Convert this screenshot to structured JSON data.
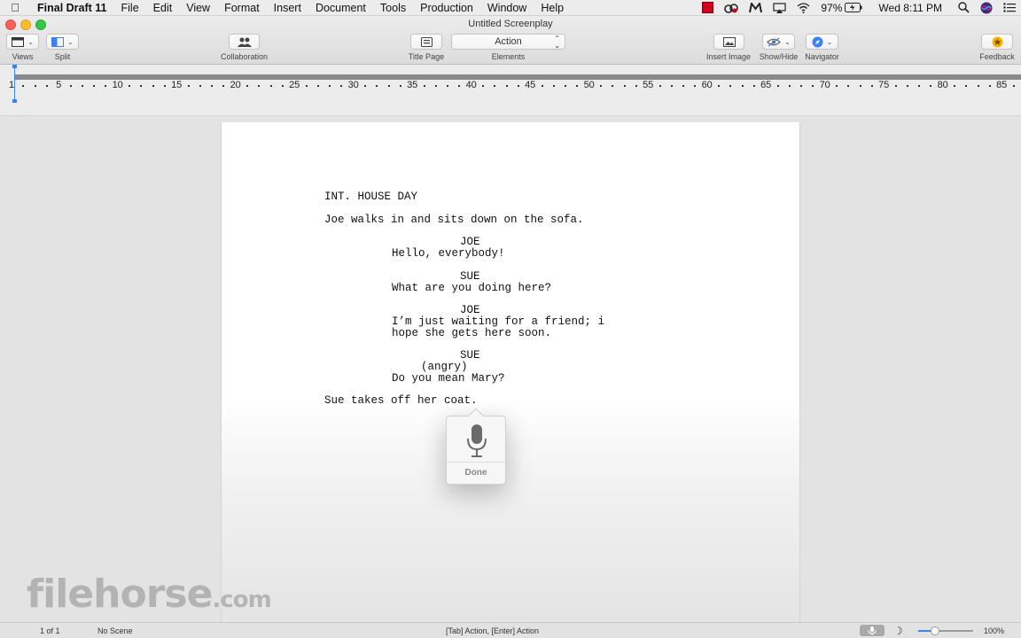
{
  "menubar": {
    "app_name": "Final Draft 11",
    "items": [
      "File",
      "Edit",
      "View",
      "Format",
      "Insert",
      "Document",
      "Tools",
      "Production",
      "Window",
      "Help"
    ],
    "battery": "97%",
    "clock": "Wed 8:11 PM"
  },
  "window": {
    "title": "Untitled Screenplay"
  },
  "toolbar": {
    "views": "Views",
    "split": "Split",
    "collaboration": "Collaboration",
    "title_page": "Title Page",
    "elements_label": "Elements",
    "elements_value": "Action",
    "insert_image": "Insert Image",
    "show_hide": "Show/Hide",
    "navigator": "Navigator",
    "feedback": "Feedback"
  },
  "ruler": {
    "numbers": [
      "1",
      "5",
      "10",
      "15",
      "20",
      "25",
      "30",
      "35",
      "40",
      "45",
      "50",
      "55",
      "60",
      "65",
      "70",
      "75",
      "80",
      "85"
    ]
  },
  "script": {
    "scene_heading": "INT. HOUSE DAY",
    "action1": "Joe walks in and sits down on the sofa.",
    "char1": "JOE",
    "dialog1": "Hello, everybody!",
    "char2": "SUE",
    "dialog2": "What are you doing here?",
    "char3": "JOE",
    "dialog3_line1": "I’m just waiting for a friend; i",
    "dialog3_line2": "hope she gets here soon.",
    "char4": "SUE",
    "paren4": "(angry)",
    "dialog4": "Do you mean Mary?",
    "action2": "Sue takes off her coat."
  },
  "dictation": {
    "done_label": "Done"
  },
  "statusbar": {
    "page": "1 of 1",
    "scene": "No Scene",
    "hint": "[Tab]  Action,  [Enter] Action",
    "zoom": "100%",
    "zoom_level": 0.3
  },
  "watermark": {
    "text": "filehorse",
    "suffix": ".com"
  }
}
